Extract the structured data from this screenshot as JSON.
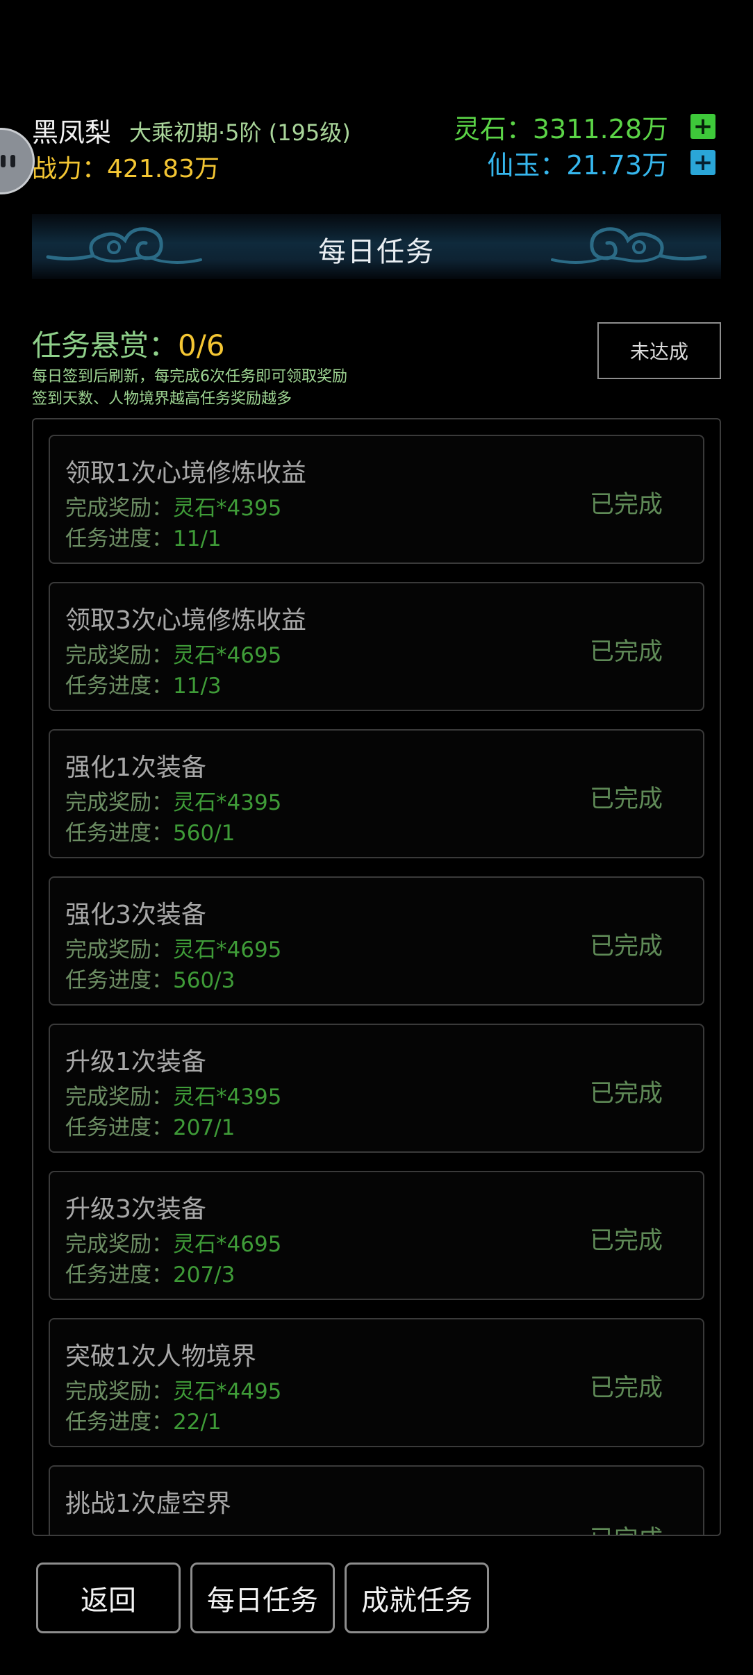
{
  "header": {
    "name": "黑凤梨",
    "realm": "大乘初期·5阶 (195级)",
    "power_label": "战力：",
    "power_value": "421.83万",
    "spirit_stone_label": "灵石：",
    "spirit_stone_value": "3311.28万",
    "jade_label": "仙玉：",
    "jade_value": "21.73万",
    "plus_icon": "+"
  },
  "banner": {
    "title": "每日任务"
  },
  "bounty": {
    "label": "任务悬赏：",
    "count": "0/6",
    "note_1": "每日签到后刷新，每完成6次任务即可领取奖励",
    "note_2": "签到天数、人物境界越高任务奖励越多",
    "status_button": "未达成"
  },
  "tasks": [
    {
      "name": "领取1次心境修炼收益",
      "reward_label": "完成奖励：",
      "reward": "灵石*4395",
      "progress_label": "任务进度：",
      "progress": "11/1",
      "status": "已完成"
    },
    {
      "name": "领取3次心境修炼收益",
      "reward_label": "完成奖励：",
      "reward": "灵石*4695",
      "progress_label": "任务进度：",
      "progress": "11/3",
      "status": "已完成"
    },
    {
      "name": "强化1次装备",
      "reward_label": "完成奖励：",
      "reward": "灵石*4395",
      "progress_label": "任务进度：",
      "progress": "560/1",
      "status": "已完成"
    },
    {
      "name": "强化3次装备",
      "reward_label": "完成奖励：",
      "reward": "灵石*4695",
      "progress_label": "任务进度：",
      "progress": "560/3",
      "status": "已完成"
    },
    {
      "name": "升级1次装备",
      "reward_label": "完成奖励：",
      "reward": "灵石*4395",
      "progress_label": "任务进度：",
      "progress": "207/1",
      "status": "已完成"
    },
    {
      "name": "升级3次装备",
      "reward_label": "完成奖励：",
      "reward": "灵石*4695",
      "progress_label": "任务进度：",
      "progress": "207/3",
      "status": "已完成"
    },
    {
      "name": "突破1次人物境界",
      "reward_label": "完成奖励：",
      "reward": "灵石*4495",
      "progress_label": "任务进度：",
      "progress": "22/1",
      "status": "已完成"
    },
    {
      "name": "挑战1次虚空界",
      "reward_label": "",
      "reward": "",
      "progress_label": "",
      "progress": "",
      "status": "已完成"
    }
  ],
  "bottom_nav": {
    "back": "返回",
    "daily": "每日任务",
    "achievement": "成就任务"
  }
}
